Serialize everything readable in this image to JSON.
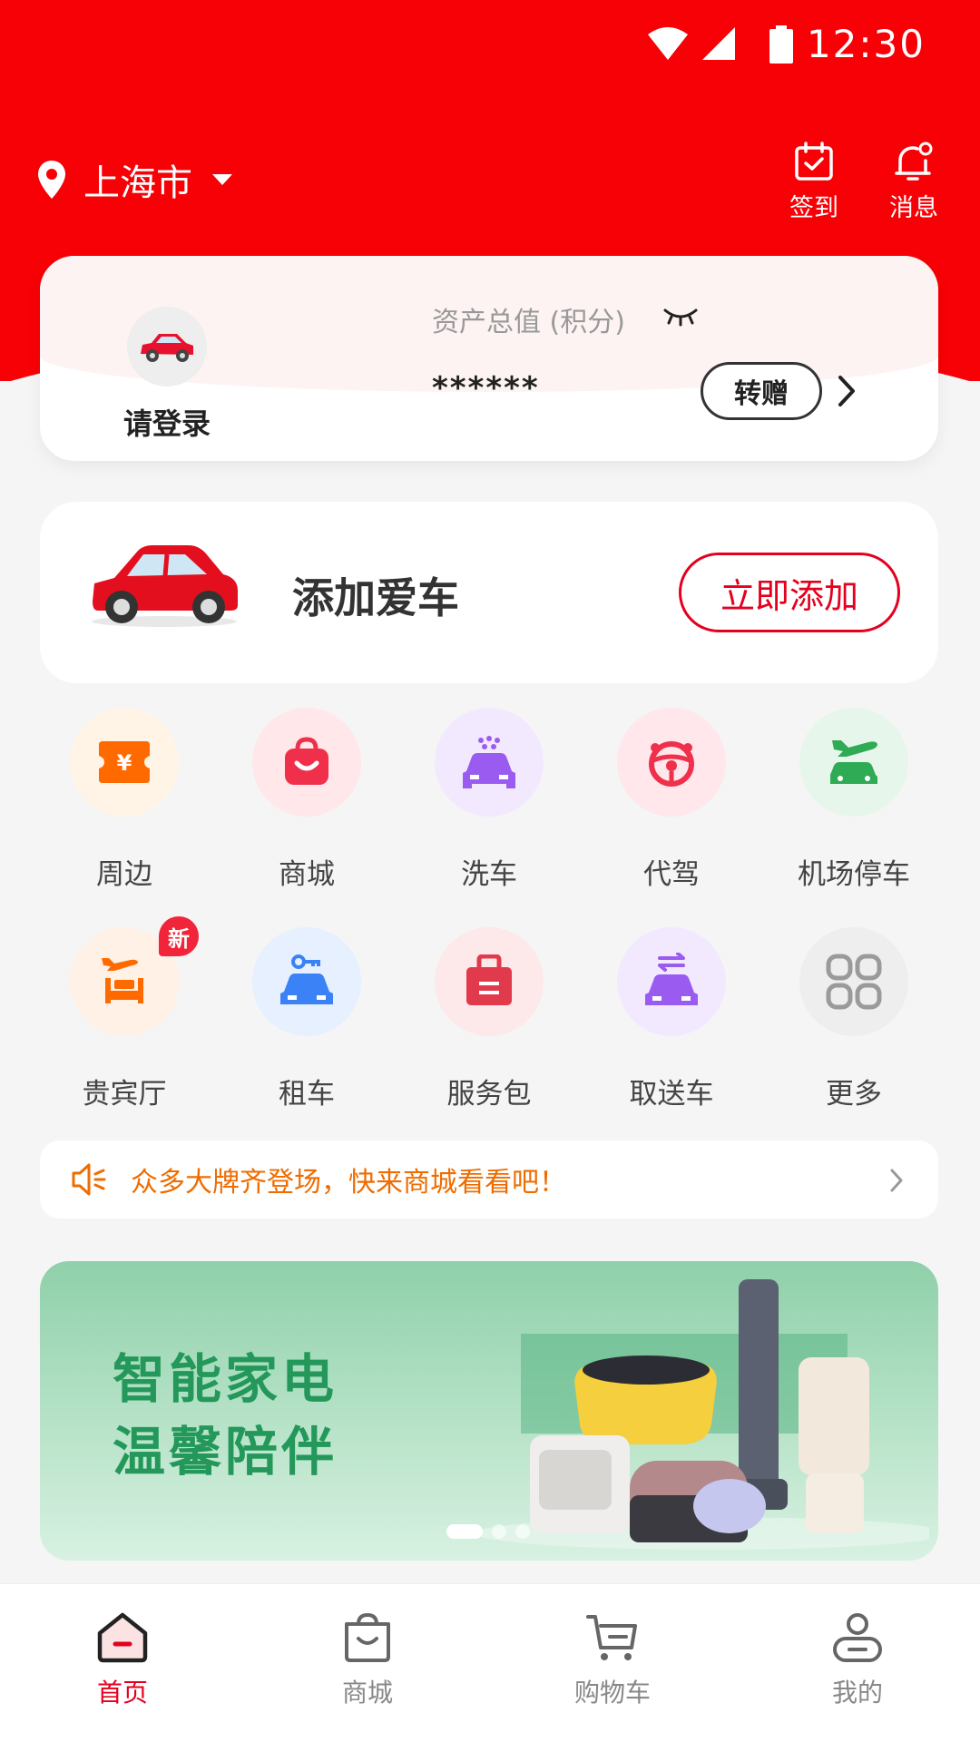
{
  "status_bar": {
    "time": "12:30"
  },
  "header": {
    "city": "上海市",
    "checkin_label": "签到",
    "messages_label": "消息"
  },
  "account": {
    "login_prompt": "请登录",
    "asset_label": "资产总值 (积分)",
    "asset_value": "******",
    "transfer_label": "转赠"
  },
  "add_car": {
    "title": "添加爱车",
    "button_label": "立即添加"
  },
  "services": [
    {
      "label": "周边",
      "icon": "ticket-icon",
      "bg": "#fff4e6",
      "color": "#ff6a00"
    },
    {
      "label": "商城",
      "icon": "shopping-bag-icon",
      "bg": "#ffe7ea",
      "color": "#f0304a"
    },
    {
      "label": "洗车",
      "icon": "car-wash-icon",
      "bg": "#f3e9ff",
      "color": "#9a5cf0"
    },
    {
      "label": "代驾",
      "icon": "steering-wheel-icon",
      "bg": "#ffe7ec",
      "color": "#f0304a"
    },
    {
      "label": "机场停车",
      "icon": "airport-parking-icon",
      "bg": "#e7f6ea",
      "color": "#2faa55"
    },
    {
      "label": "贵宾厅",
      "icon": "vip-lounge-icon",
      "bg": "#fff1e6",
      "color": "#ff6a00",
      "badge": "新"
    },
    {
      "label": "租车",
      "icon": "car-rental-icon",
      "bg": "#e6f0ff",
      "color": "#3b82f6"
    },
    {
      "label": "服务包",
      "icon": "service-package-icon",
      "bg": "#fde9ea",
      "color": "#e23a4d"
    },
    {
      "label": "取送车",
      "icon": "car-pickup-icon",
      "bg": "#f3e9ff",
      "color": "#9a5cf0"
    },
    {
      "label": "更多",
      "icon": "grid-more-icon",
      "bg": "#eeeeee",
      "color": "#9a9a9a"
    }
  ],
  "notice": {
    "text": "众多大牌齐登场，快来商城看看吧！"
  },
  "banner": {
    "line1": "智能家电",
    "line2": "温馨陪伴"
  },
  "bottom_nav": [
    {
      "label": "首页",
      "icon": "home-icon",
      "active": true
    },
    {
      "label": "商城",
      "icon": "shopping-bag-icon"
    },
    {
      "label": "购物车",
      "icon": "cart-icon"
    },
    {
      "label": "我的",
      "icon": "profile-icon"
    }
  ],
  "colors": {
    "brand_red": "#f70006",
    "accent_red": "#e4001e",
    "notice_orange": "#ef6c00",
    "banner_green": "#23985a"
  }
}
